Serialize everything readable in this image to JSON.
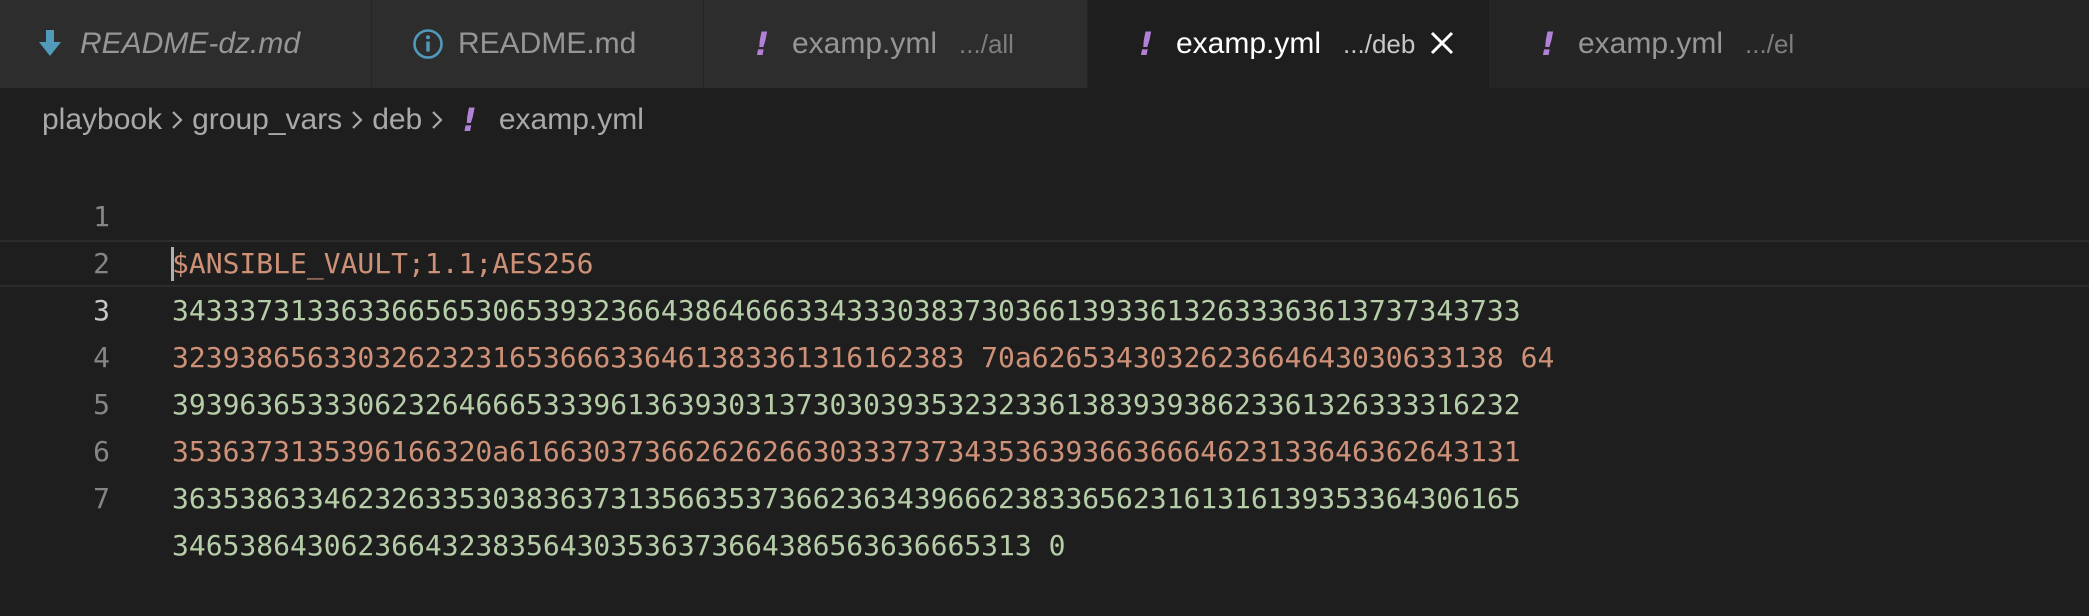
{
  "tabs": [
    {
      "name": "README-dz.md",
      "desc": "",
      "icon": "download-arrow-icon",
      "icon_color": "#519aba",
      "italic": true,
      "active": false
    },
    {
      "name": "README.md",
      "desc": "",
      "icon": "info-icon",
      "icon_color": "#519aba",
      "italic": false,
      "active": false
    },
    {
      "name": "examp.yml",
      "desc": ".../all",
      "icon": "yaml-exclamation-icon",
      "icon_color": "#b180d7",
      "italic": false,
      "active": false
    },
    {
      "name": "examp.yml",
      "desc": ".../deb",
      "icon": "yaml-exclamation-icon",
      "icon_color": "#b180d7",
      "italic": false,
      "active": true
    },
    {
      "name": "examp.yml",
      "desc": ".../el",
      "icon": "yaml-exclamation-icon",
      "icon_color": "#b180d7",
      "italic": false,
      "active": false
    }
  ],
  "breadcrumb": {
    "segments": [
      "playbook",
      "group_vars",
      "deb"
    ],
    "file": "examp.yml",
    "bang": "!"
  },
  "editor": {
    "current_line": 3,
    "lines": [
      {
        "number": "1",
        "text": "$ANSIBLE_VAULT;1.1;AES256",
        "color": "#ce9178"
      },
      {
        "number": "2",
        "text": "34333731336336656530653932366438646663343330383730366139336132633363613737343733",
        "color": "#b5cea8"
      },
      {
        "number": "3",
        "text": "32393865633032623231653666336461383361316162383 70a6265343032623664643030633138 64",
        "color": "#ce9178"
      },
      {
        "number": "4",
        "text": "39396365333062326466653339613639303137303039353232336138393938623361326333316232",
        "color": "#b5cea8"
      },
      {
        "number": "5",
        "text": "3536373135396166320a616630373662626266303337373435363936636664623133646362643131",
        "color": "#ce9178"
      },
      {
        "number": "6",
        "text": "36353863346232633530383637313566353736623634396662383365623161316139353364306165",
        "color": "#b5cea8"
      },
      {
        "number": "7",
        "text": "346538643062366432383564303536373664386563636665313 0",
        "color": "#b5cea8"
      }
    ]
  }
}
